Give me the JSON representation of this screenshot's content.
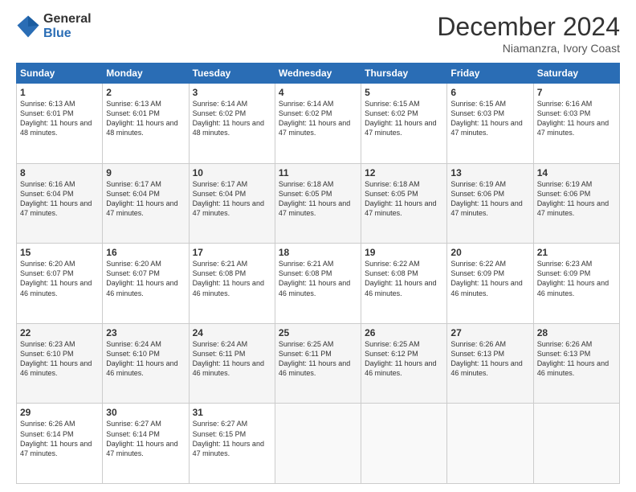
{
  "header": {
    "logo_general": "General",
    "logo_blue": "Blue",
    "month_title": "December 2024",
    "subtitle": "Niamanzra, Ivory Coast"
  },
  "days_of_week": [
    "Sunday",
    "Monday",
    "Tuesday",
    "Wednesday",
    "Thursday",
    "Friday",
    "Saturday"
  ],
  "weeks": [
    [
      {
        "day": "1",
        "sunrise": "6:13 AM",
        "sunset": "6:01 PM",
        "daylight": "11 hours and 48 minutes."
      },
      {
        "day": "2",
        "sunrise": "6:13 AM",
        "sunset": "6:01 PM",
        "daylight": "11 hours and 48 minutes."
      },
      {
        "day": "3",
        "sunrise": "6:14 AM",
        "sunset": "6:02 PM",
        "daylight": "11 hours and 48 minutes."
      },
      {
        "day": "4",
        "sunrise": "6:14 AM",
        "sunset": "6:02 PM",
        "daylight": "11 hours and 47 minutes."
      },
      {
        "day": "5",
        "sunrise": "6:15 AM",
        "sunset": "6:02 PM",
        "daylight": "11 hours and 47 minutes."
      },
      {
        "day": "6",
        "sunrise": "6:15 AM",
        "sunset": "6:03 PM",
        "daylight": "11 hours and 47 minutes."
      },
      {
        "day": "7",
        "sunrise": "6:16 AM",
        "sunset": "6:03 PM",
        "daylight": "11 hours and 47 minutes."
      }
    ],
    [
      {
        "day": "8",
        "sunrise": "6:16 AM",
        "sunset": "6:04 PM",
        "daylight": "11 hours and 47 minutes."
      },
      {
        "day": "9",
        "sunrise": "6:17 AM",
        "sunset": "6:04 PM",
        "daylight": "11 hours and 47 minutes."
      },
      {
        "day": "10",
        "sunrise": "6:17 AM",
        "sunset": "6:04 PM",
        "daylight": "11 hours and 47 minutes."
      },
      {
        "day": "11",
        "sunrise": "6:18 AM",
        "sunset": "6:05 PM",
        "daylight": "11 hours and 47 minutes."
      },
      {
        "day": "12",
        "sunrise": "6:18 AM",
        "sunset": "6:05 PM",
        "daylight": "11 hours and 47 minutes."
      },
      {
        "day": "13",
        "sunrise": "6:19 AM",
        "sunset": "6:06 PM",
        "daylight": "11 hours and 47 minutes."
      },
      {
        "day": "14",
        "sunrise": "6:19 AM",
        "sunset": "6:06 PM",
        "daylight": "11 hours and 47 minutes."
      }
    ],
    [
      {
        "day": "15",
        "sunrise": "6:20 AM",
        "sunset": "6:07 PM",
        "daylight": "11 hours and 46 minutes."
      },
      {
        "day": "16",
        "sunrise": "6:20 AM",
        "sunset": "6:07 PM",
        "daylight": "11 hours and 46 minutes."
      },
      {
        "day": "17",
        "sunrise": "6:21 AM",
        "sunset": "6:08 PM",
        "daylight": "11 hours and 46 minutes."
      },
      {
        "day": "18",
        "sunrise": "6:21 AM",
        "sunset": "6:08 PM",
        "daylight": "11 hours and 46 minutes."
      },
      {
        "day": "19",
        "sunrise": "6:22 AM",
        "sunset": "6:08 PM",
        "daylight": "11 hours and 46 minutes."
      },
      {
        "day": "20",
        "sunrise": "6:22 AM",
        "sunset": "6:09 PM",
        "daylight": "11 hours and 46 minutes."
      },
      {
        "day": "21",
        "sunrise": "6:23 AM",
        "sunset": "6:09 PM",
        "daylight": "11 hours and 46 minutes."
      }
    ],
    [
      {
        "day": "22",
        "sunrise": "6:23 AM",
        "sunset": "6:10 PM",
        "daylight": "11 hours and 46 minutes."
      },
      {
        "day": "23",
        "sunrise": "6:24 AM",
        "sunset": "6:10 PM",
        "daylight": "11 hours and 46 minutes."
      },
      {
        "day": "24",
        "sunrise": "6:24 AM",
        "sunset": "6:11 PM",
        "daylight": "11 hours and 46 minutes."
      },
      {
        "day": "25",
        "sunrise": "6:25 AM",
        "sunset": "6:11 PM",
        "daylight": "11 hours and 46 minutes."
      },
      {
        "day": "26",
        "sunrise": "6:25 AM",
        "sunset": "6:12 PM",
        "daylight": "11 hours and 46 minutes."
      },
      {
        "day": "27",
        "sunrise": "6:26 AM",
        "sunset": "6:13 PM",
        "daylight": "11 hours and 46 minutes."
      },
      {
        "day": "28",
        "sunrise": "6:26 AM",
        "sunset": "6:13 PM",
        "daylight": "11 hours and 46 minutes."
      }
    ],
    [
      {
        "day": "29",
        "sunrise": "6:26 AM",
        "sunset": "6:14 PM",
        "daylight": "11 hours and 47 minutes."
      },
      {
        "day": "30",
        "sunrise": "6:27 AM",
        "sunset": "6:14 PM",
        "daylight": "11 hours and 47 minutes."
      },
      {
        "day": "31",
        "sunrise": "6:27 AM",
        "sunset": "6:15 PM",
        "daylight": "11 hours and 47 minutes."
      },
      {
        "day": "",
        "sunrise": "",
        "sunset": "",
        "daylight": ""
      },
      {
        "day": "",
        "sunrise": "",
        "sunset": "",
        "daylight": ""
      },
      {
        "day": "",
        "sunrise": "",
        "sunset": "",
        "daylight": ""
      },
      {
        "day": "",
        "sunrise": "",
        "sunset": "",
        "daylight": ""
      }
    ]
  ]
}
